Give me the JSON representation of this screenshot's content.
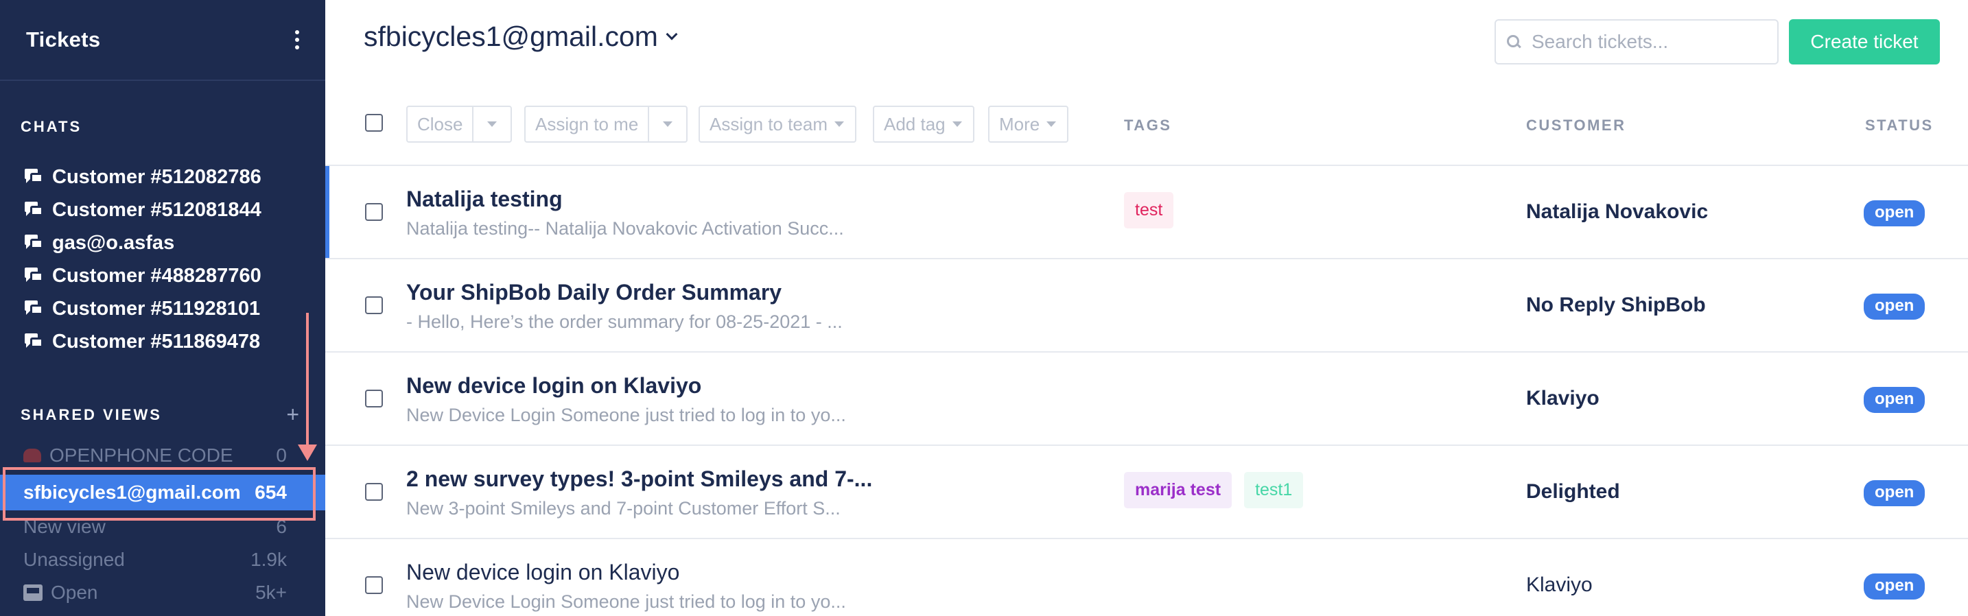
{
  "sidebar": {
    "title": "Tickets",
    "chats_header": "CHATS",
    "chats": [
      {
        "label": "Customer #512082786"
      },
      {
        "label": "Customer #512081844"
      },
      {
        "label": "gas@o.asfas"
      },
      {
        "label": "Customer #488287760"
      },
      {
        "label": "Customer #511928101"
      },
      {
        "label": "Customer #511869478"
      }
    ],
    "shared_views_header": "SHARED VIEWS",
    "add_view_symbol": "+",
    "views": [
      {
        "label": "OPENPHONE CODE",
        "count": "0"
      },
      {
        "label": "sfbicycles1@gmail.com",
        "count": "654"
      },
      {
        "label": "New view",
        "count": "6"
      },
      {
        "label": "Unassigned",
        "count": "1.9k"
      },
      {
        "label": "Open",
        "count": "5k+"
      }
    ]
  },
  "header": {
    "view_title": "sfbicycles1@gmail.com",
    "search_placeholder": "Search tickets...",
    "create_button": "Create ticket"
  },
  "toolbar": {
    "close": "Close",
    "assign_to_me": "Assign to me",
    "assign_to_team": "Assign to team",
    "add_tag": "Add tag",
    "more": "More",
    "col_tags": "TAGS",
    "col_customer": "CUSTOMER",
    "col_status": "STATUS"
  },
  "colors": {
    "sidebar_bg": "#1d2b4f",
    "accent_blue": "#3e7de8",
    "create_green": "#2ecc9a",
    "highlight_annotation": "#f28c8c"
  },
  "tickets": [
    {
      "subject": "Natalija testing",
      "excerpt": "Natalija testing-- Natalija Novakovic Activation Succ...",
      "tags": [
        {
          "label": "test",
          "color": "#e0245e",
          "bg": "#fdeef3"
        }
      ],
      "customer": "Natalija Novakovic",
      "status": "open"
    },
    {
      "subject": "Your ShipBob Daily Order Summary",
      "excerpt": "- Hello, Here’s the order summary for 08-25-2021 - ...",
      "tags": [],
      "customer": "No Reply ShipBob",
      "status": "open"
    },
    {
      "subject": "New device login on Klaviyo",
      "excerpt": "New Device Login Someone just tried to log in to yo...",
      "tags": [],
      "customer": "Klaviyo",
      "status": "open"
    },
    {
      "subject": "2 new survey types! 3-point Smileys and 7-...",
      "excerpt": "New 3-point Smileys and 7-point Customer Effort S...",
      "tags": [
        {
          "label": "marija test",
          "color": "#9b2fc9",
          "bg": "#f4ecfa"
        },
        {
          "label": "test1",
          "color": "#46d6a6",
          "bg": "#edfaf5"
        }
      ],
      "customer": "Delighted",
      "status": "open"
    },
    {
      "subject": "New device login on Klaviyo",
      "excerpt": "New Device Login Someone just tried to log in to yo...",
      "tags": [],
      "customer": "Klaviyo",
      "status": "open"
    }
  ]
}
